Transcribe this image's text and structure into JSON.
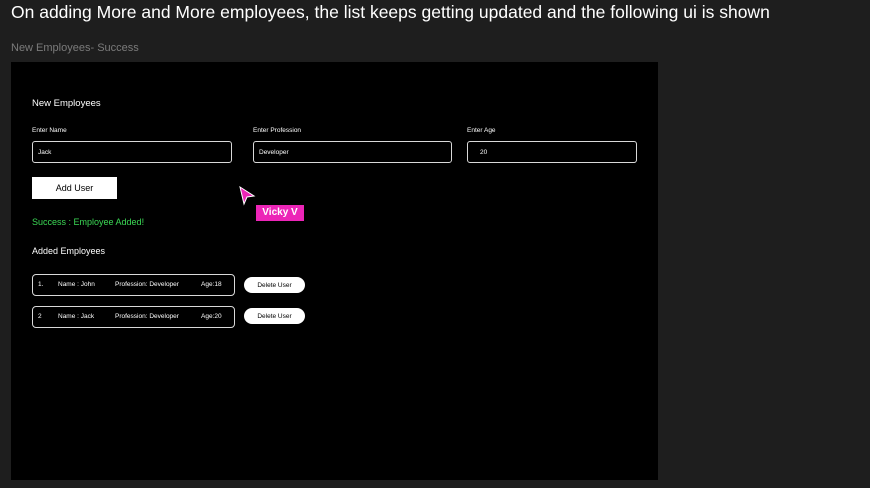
{
  "heading": "On adding More and More employees, the list keeps getting updated and the following ui is shown",
  "frame_label": "New Employees- Success",
  "form": {
    "title": "New Employees",
    "name_label": "Enter Name",
    "name_value": "Jack",
    "profession_label": "Enter Profession",
    "profession_value": "Developer",
    "age_label": "Enter Age",
    "age_value": "20",
    "add_button": "Add User"
  },
  "success_message": "Success : Employee Added!",
  "added_title": "Added Employees",
  "employees": [
    {
      "index": "1.",
      "name": "Name : John",
      "profession": "Profession: Developer",
      "age": "Age:18",
      "delete_label": "Delete User"
    },
    {
      "index": "2",
      "name": "Name : Jack",
      "profession": "Profession: Developer",
      "age": "Age:20",
      "delete_label": "Delete User"
    }
  ],
  "collaborator": {
    "name": "Vicky V",
    "color": "#ec25b7"
  },
  "colors": {
    "success": "#3bd955",
    "page_bg": "#1e1e1e",
    "frame_bg": "#000000"
  }
}
